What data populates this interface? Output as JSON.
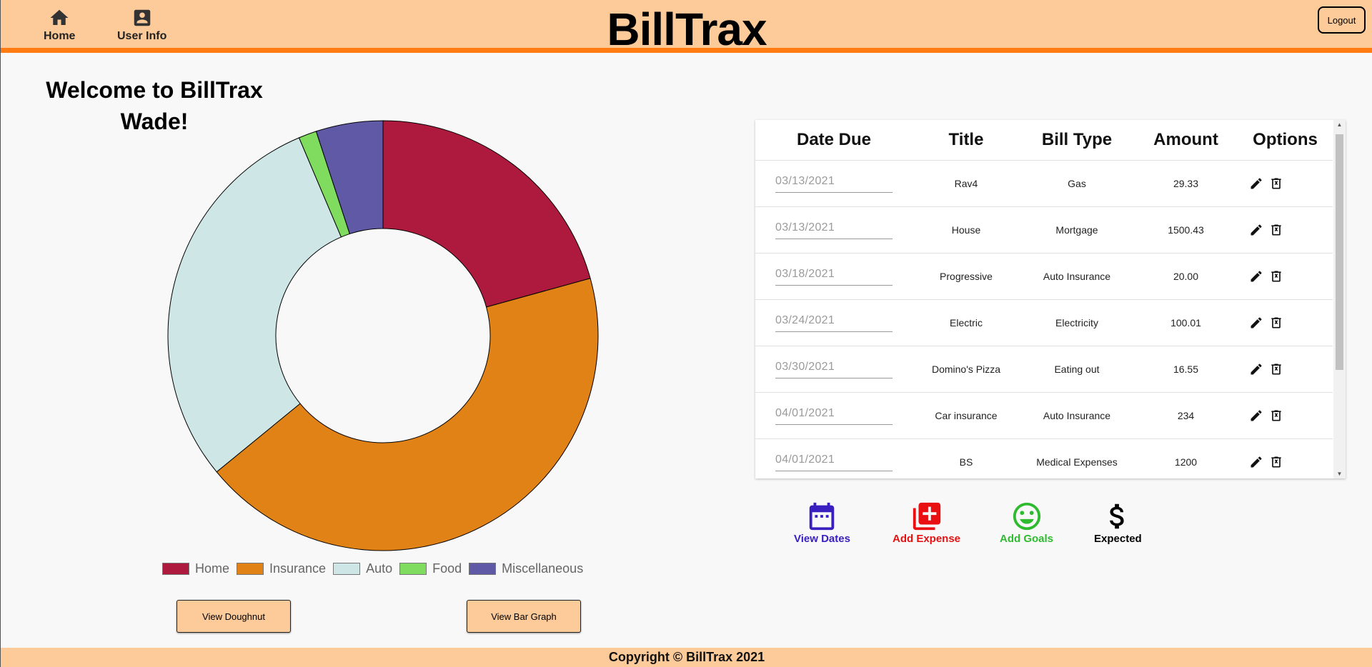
{
  "header": {
    "brand": "BillTrax",
    "nav": [
      {
        "label": "Home",
        "icon": "home-icon"
      },
      {
        "label": "User Info",
        "icon": "account-box-icon"
      }
    ],
    "logout_label": "Logout"
  },
  "welcome": {
    "line1": "Welcome to BillTrax",
    "line2": "Wade!"
  },
  "chart_data": {
    "type": "pie",
    "variant": "doughnut",
    "categories": [
      "Home",
      "Insurance",
      "Auto",
      "Food",
      "Miscellaneous"
    ],
    "values": [
      1529.76,
      3204.43,
      2183.0,
      100.01,
      371.55
    ],
    "colors": [
      "#ad1a3e",
      "#e08215",
      "#cfe6e6",
      "#7fdc5f",
      "#5f59a6"
    ],
    "legend_position": "bottom"
  },
  "chart_buttons": {
    "doughnut": "View Doughnut",
    "bar": "View Bar Graph"
  },
  "table": {
    "headers": [
      "Date Due",
      "Title",
      "Bill Type",
      "Amount",
      "Options"
    ],
    "rows": [
      {
        "date": "03/13/2021",
        "title": "Rav4",
        "type": "Gas",
        "amount": "29.33"
      },
      {
        "date": "03/13/2021",
        "title": "House",
        "type": "Mortgage",
        "amount": "1500.43"
      },
      {
        "date": "03/18/2021",
        "title": "Progressive",
        "type": "Auto Insurance",
        "amount": "20.00"
      },
      {
        "date": "03/24/2021",
        "title": "Electric",
        "type": "Electricity",
        "amount": "100.01"
      },
      {
        "date": "03/30/2021",
        "title": "Domino's Pizza",
        "type": "Eating out",
        "amount": "16.55"
      },
      {
        "date": "04/01/2021",
        "title": "Car insurance",
        "type": "Auto Insurance",
        "amount": "234"
      },
      {
        "date": "04/01/2021",
        "title": "BS",
        "type": "Medical Expenses",
        "amount": "1200"
      }
    ]
  },
  "actions": [
    {
      "label": "View Dates",
      "icon": "calendar-icon",
      "color": "#3a1fc0"
    },
    {
      "label": "Add Expense",
      "icon": "add-expense-icon",
      "color": "#e81010"
    },
    {
      "label": "Add Goals",
      "icon": "smiley-icon",
      "color": "#2fbb2f"
    },
    {
      "label": "Expected",
      "icon": "dollar-icon",
      "color": "#000000"
    }
  ],
  "footer": "Copyright © BillTrax 2021"
}
